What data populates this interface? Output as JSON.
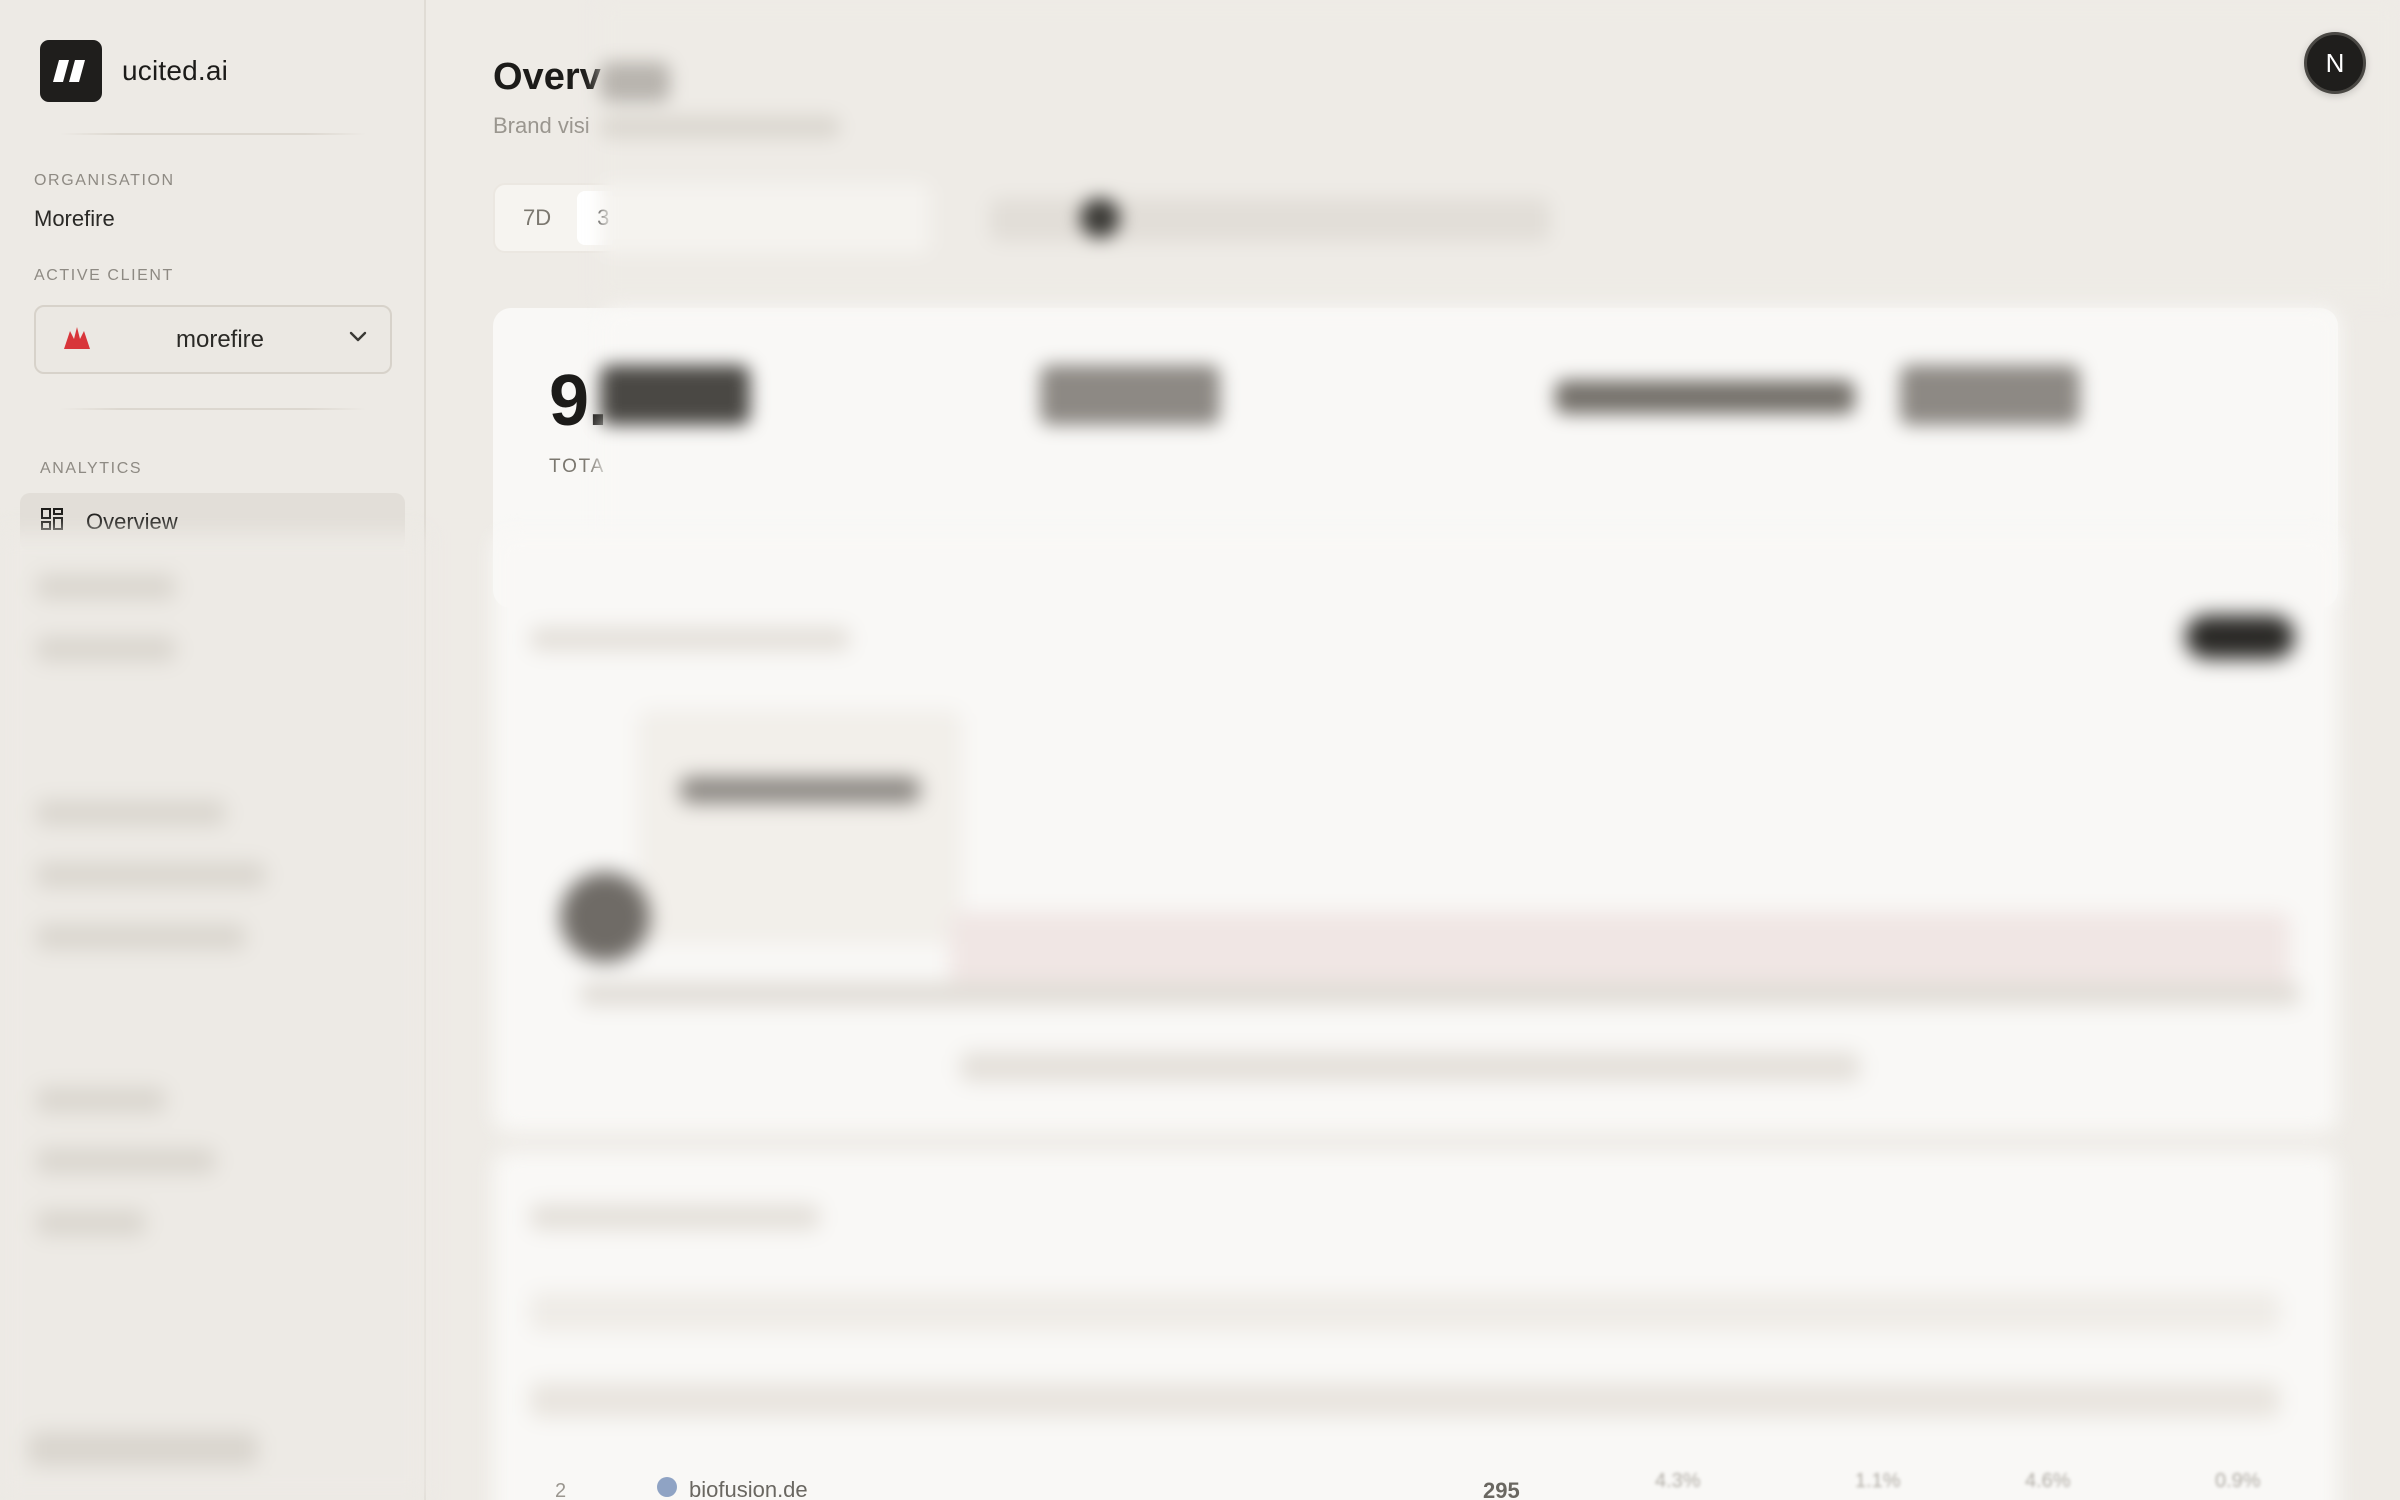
{
  "brand": {
    "name": "ucited.ai"
  },
  "sidebar": {
    "organisation_label": "ORGANISATION",
    "organisation_name": "Morefire",
    "active_client_label": "ACTIVE CLIENT",
    "active_client": "morefire",
    "analytics_label": "ANALYTICS",
    "nav_items": [
      {
        "label": "Overview",
        "icon": "grid-icon",
        "active": true
      }
    ]
  },
  "header": {
    "title": "Overv",
    "subtitle": "Brand visi"
  },
  "time_range": {
    "options": [
      "7D",
      "3"
    ],
    "selected": "3"
  },
  "user": {
    "avatar_initial": "N"
  },
  "stats": {
    "total_value": "9.",
    "total_caption": "TOTA"
  },
  "table_preview": {
    "rank": "2",
    "domain": "biofusion.de",
    "value": "295",
    "cols": [
      "4.3%",
      "1.1%",
      "4.6%",
      "0.9%"
    ]
  },
  "colors": {
    "background": "#eeebe6",
    "card": "#f9f8f6",
    "accent_dark": "#1f1e1c",
    "client_logo": "#d8353a"
  }
}
